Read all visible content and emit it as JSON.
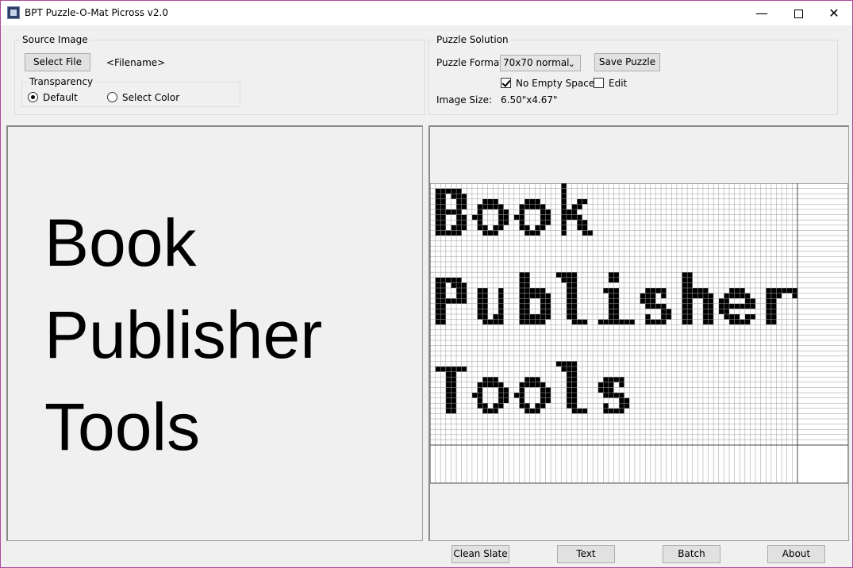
{
  "window": {
    "title": "BPT Puzzle-O-Mat Picross v2.0"
  },
  "source_image": {
    "legend": "Source Image",
    "select_file_label": "Select File",
    "filename": "<Filename>",
    "transparency": {
      "legend": "Transparency",
      "default_label": "Default",
      "select_color_label": "Select Color",
      "selected": "Default"
    },
    "preview_lines": [
      "Book",
      "Publisher",
      "Tools"
    ]
  },
  "puzzle_solution": {
    "legend": "Puzzle Solution",
    "format_label": "Puzzle Format:",
    "format_value": "70x70 normal",
    "save_label": "Save Puzzle",
    "no_empty_space_label": "No Empty Space",
    "no_empty_space_checked": true,
    "edit_label": "Edit",
    "edit_checked": false,
    "image_size_label": "Image Size:",
    "image_size_value": "6.50\"x4.67\""
  },
  "footer": {
    "clean_slate_label": "Clean Slate",
    "text_label": "Text",
    "batch_label": "Batch",
    "about_label": "About"
  },
  "colors": {
    "accent_border": "#b04a9a",
    "grid_line": "#9a9a9a",
    "pixel": "#000000"
  },
  "icons": {
    "app": "bpt-app-icon",
    "minimize": "minimize-icon",
    "maximize": "maximize-icon",
    "close": "close-icon"
  }
}
